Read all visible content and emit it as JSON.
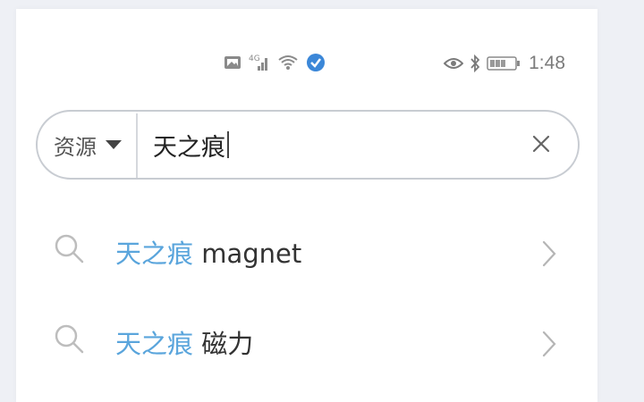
{
  "status_bar": {
    "time": "1:48",
    "left_icons": [
      "gallery-icon",
      "signal-icon",
      "wifi-icon",
      "verified-badge-icon"
    ],
    "right_icons": [
      "eye-icon",
      "bluetooth-icon",
      "battery-icon"
    ]
  },
  "search": {
    "scope_label": "资源",
    "query": "天之痕"
  },
  "suggestions": [
    {
      "highlight": "天之痕",
      "suffix": " magnet"
    },
    {
      "highlight": "天之痕",
      "suffix": " 磁力"
    }
  ],
  "colors": {
    "highlight": "#5aa5dc",
    "background": "#eef0f5"
  }
}
